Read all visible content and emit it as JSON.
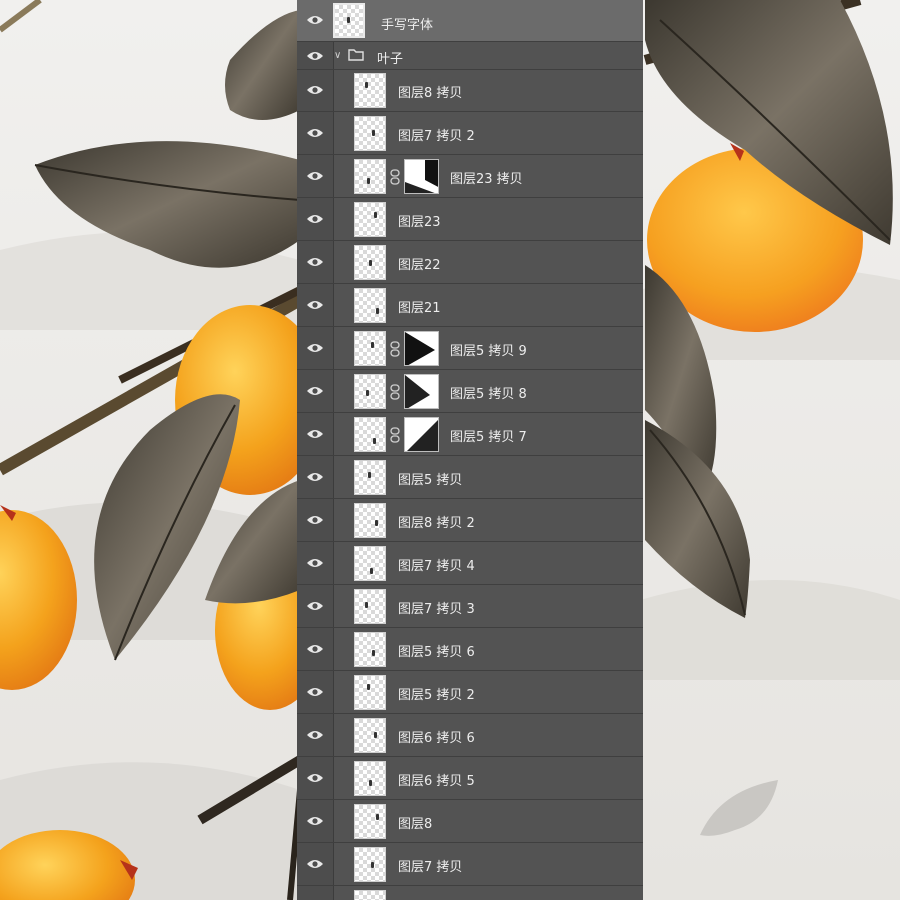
{
  "colors": {
    "panel_bg": "#535353",
    "selected_row": "#6b6b6b",
    "persimmon": "#f3a820",
    "leaf": "#4f4a40"
  },
  "icons": {
    "visibility": "eye-icon",
    "group": "folder-icon",
    "link": "link-icon",
    "expand": "chevron-down-icon"
  },
  "layers": {
    "top_layer": {
      "name": "手写字体",
      "selected": true
    },
    "group": {
      "name": "叶子",
      "expanded": true
    },
    "items": [
      {
        "name": "图层8 拷贝"
      },
      {
        "name": "图层7 拷贝 2"
      },
      {
        "name": "图层23 拷贝",
        "has_mask": true
      },
      {
        "name": "图层23"
      },
      {
        "name": "图层22"
      },
      {
        "name": "图层21"
      },
      {
        "name": "图层5 拷贝 9",
        "has_mask": true
      },
      {
        "name": "图层5 拷贝 8",
        "has_mask": true
      },
      {
        "name": "图层5 拷贝 7",
        "has_mask": true
      },
      {
        "name": "图层5 拷贝"
      },
      {
        "name": "图层8 拷贝 2"
      },
      {
        "name": "图层7 拷贝 4"
      },
      {
        "name": "图层7 拷贝 3"
      },
      {
        "name": "图层5 拷贝 6"
      },
      {
        "name": "图层5 拷贝 2"
      },
      {
        "name": "图层6 拷贝 6"
      },
      {
        "name": "图层6 拷贝 5"
      },
      {
        "name": "图层8"
      },
      {
        "name": "图层7 拷贝"
      }
    ]
  }
}
